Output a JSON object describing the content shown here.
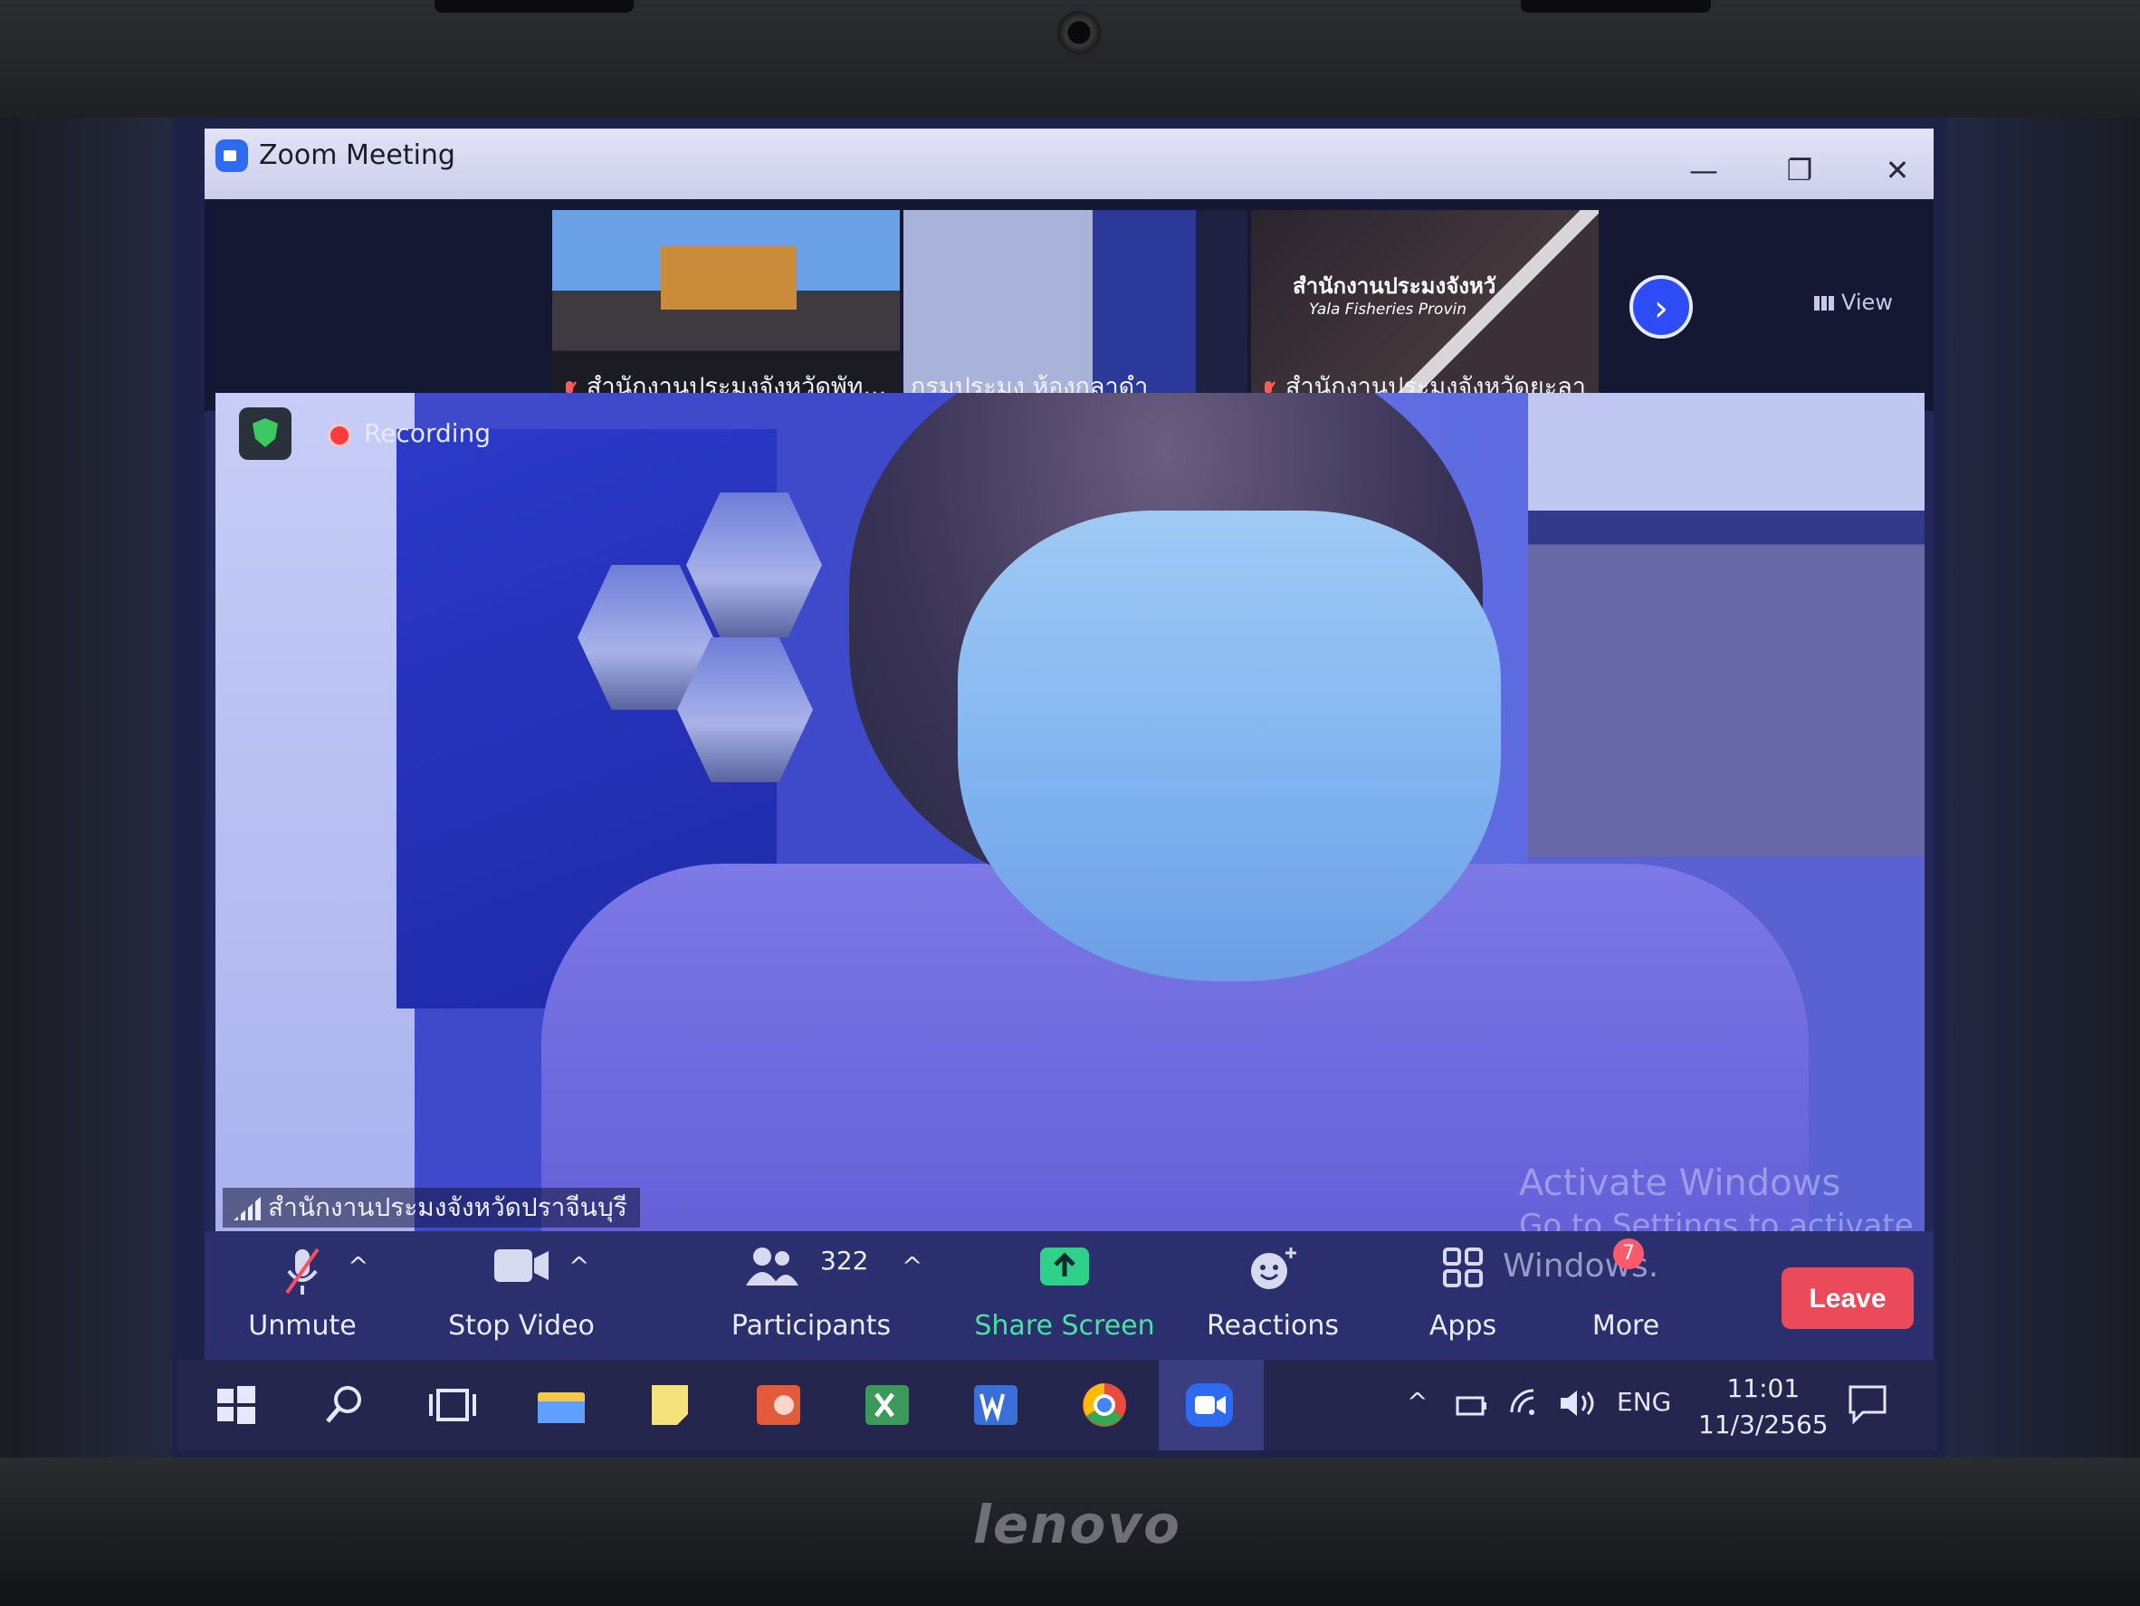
{
  "window": {
    "title": "Zoom Meeting",
    "minimize": "—",
    "restore": "❐",
    "close": "✕"
  },
  "thumbnails": [
    {
      "label": "สำนักงานประมงจังหวัดพัท...",
      "muted": true
    },
    {
      "label": "กรมประมง ห้องกุลาดำ",
      "muted": false
    },
    {
      "label": "สำนักงานประมงจังหวัดยะลา",
      "muted": true
    }
  ],
  "thumb3_sign": {
    "line1": "สำนักงานประมงจังหวั",
    "line2": "Yala Fisheries Provin"
  },
  "view_label": "View",
  "next_arrow": "›",
  "recording_label": "Recording",
  "speaker_name": "สำนักงานประมงจังหวัดปราจีนบุรี",
  "watermark": {
    "line1": "Activate Windows",
    "line2": "Go to Settings to activate",
    "line3": "Windows."
  },
  "toolbar": {
    "unmute": "Unmute",
    "stop_video": "Stop Video",
    "participants": "Participants",
    "participants_count": "322",
    "share_screen": "Share Screen",
    "reactions": "Reactions",
    "apps": "Apps",
    "more": "More",
    "more_badge": "7",
    "leave": "Leave",
    "caret": "^"
  },
  "taskbar": {
    "language": "ENG",
    "time": "11:01",
    "date": "11/3/2565"
  },
  "brand": "lenovo",
  "colors": {
    "accent_blue": "#2d4cf5",
    "share_green": "#2fd08a",
    "leave_red": "#ea4a5a",
    "recording_red": "#ff3b3b"
  }
}
